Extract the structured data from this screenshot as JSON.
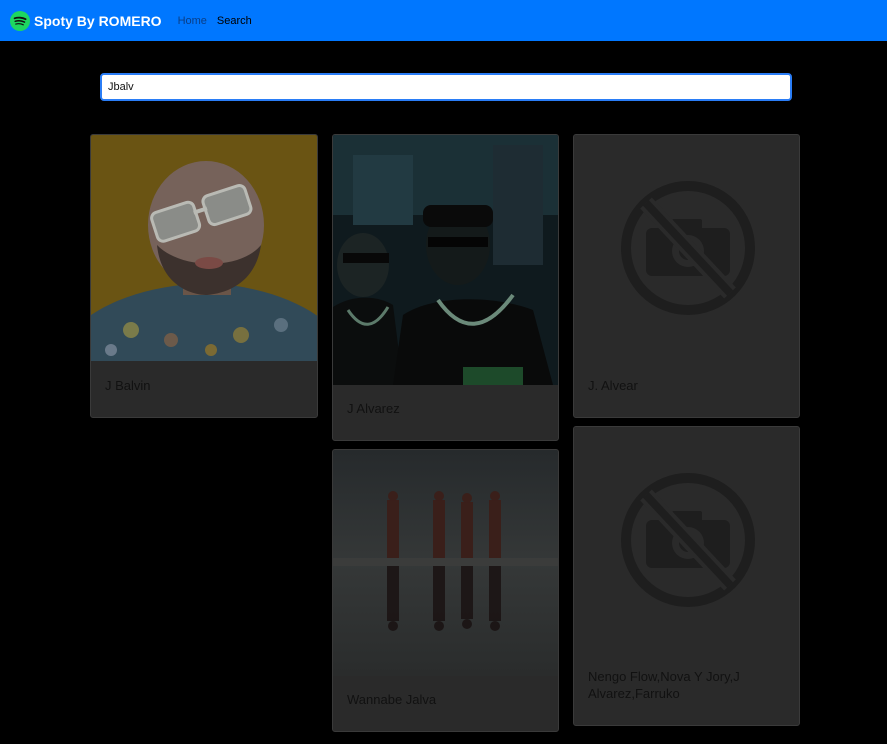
{
  "navbar": {
    "brand_name": "Spoty By ROMERO",
    "brand_icon": "spotify-icon",
    "links": [
      {
        "label": "Home"
      },
      {
        "label": "Search"
      }
    ],
    "bg_color": "#0077ff"
  },
  "search": {
    "value": "Jbalv"
  },
  "results": [
    {
      "name": "J Balvin",
      "image": "artist-photo"
    },
    {
      "name": "J Alvarez",
      "image": "artist-photo"
    },
    {
      "name": "J. Alvear",
      "image": "no-image-icon"
    },
    {
      "name": "Wannabe Jalva",
      "image": "artist-photo"
    },
    {
      "name": "Nengo Flow,Nova Y Jory,J Alvarez,Farruko",
      "image": "no-image-icon"
    }
  ]
}
